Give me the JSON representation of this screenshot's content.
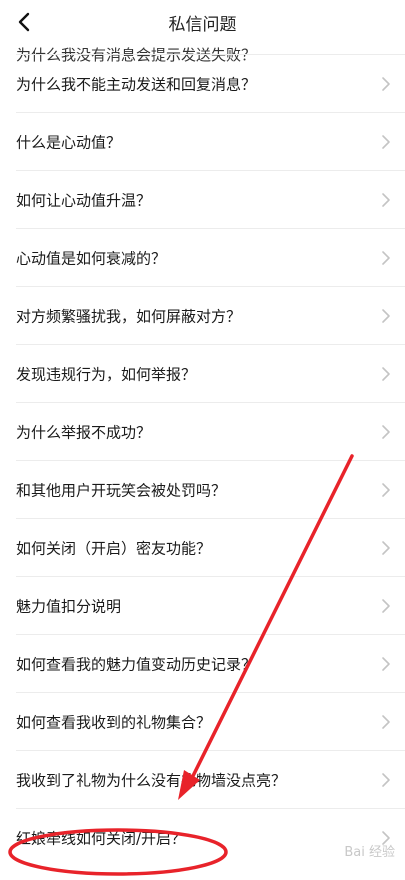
{
  "header": {
    "title": "私信问题",
    "back_icon": "chevron-left-icon"
  },
  "list": {
    "items": [
      {
        "label": "为什么我没有消息会提示发送失败？"
      },
      {
        "label": "为什么我不能主动发送和回复消息？"
      },
      {
        "label": "什么是心动值？"
      },
      {
        "label": "如何让心动值升温？"
      },
      {
        "label": "心动值是如何衰减的？"
      },
      {
        "label": "对方频繁骚扰我，如何屏蔽对方？"
      },
      {
        "label": "发现违规行为，如何举报？"
      },
      {
        "label": "为什么举报不成功？"
      },
      {
        "label": "和其他用户开玩笑会被处罚吗？"
      },
      {
        "label": "如何关闭（开启）密友功能？"
      },
      {
        "label": "魅力值扣分说明"
      },
      {
        "label": "如何查看我的魅力值变动历史记录？"
      },
      {
        "label": "如何查看我收到的礼物集合？"
      },
      {
        "label": "我收到了礼物为什么没有礼物墙没点亮？"
      },
      {
        "label": "红娘牵线如何关闭/开启？"
      }
    ],
    "chevron_icon": "chevron-right-icon"
  },
  "annotation": {
    "color": "#e8232a"
  },
  "watermark": {
    "text": "Bai 经验"
  }
}
